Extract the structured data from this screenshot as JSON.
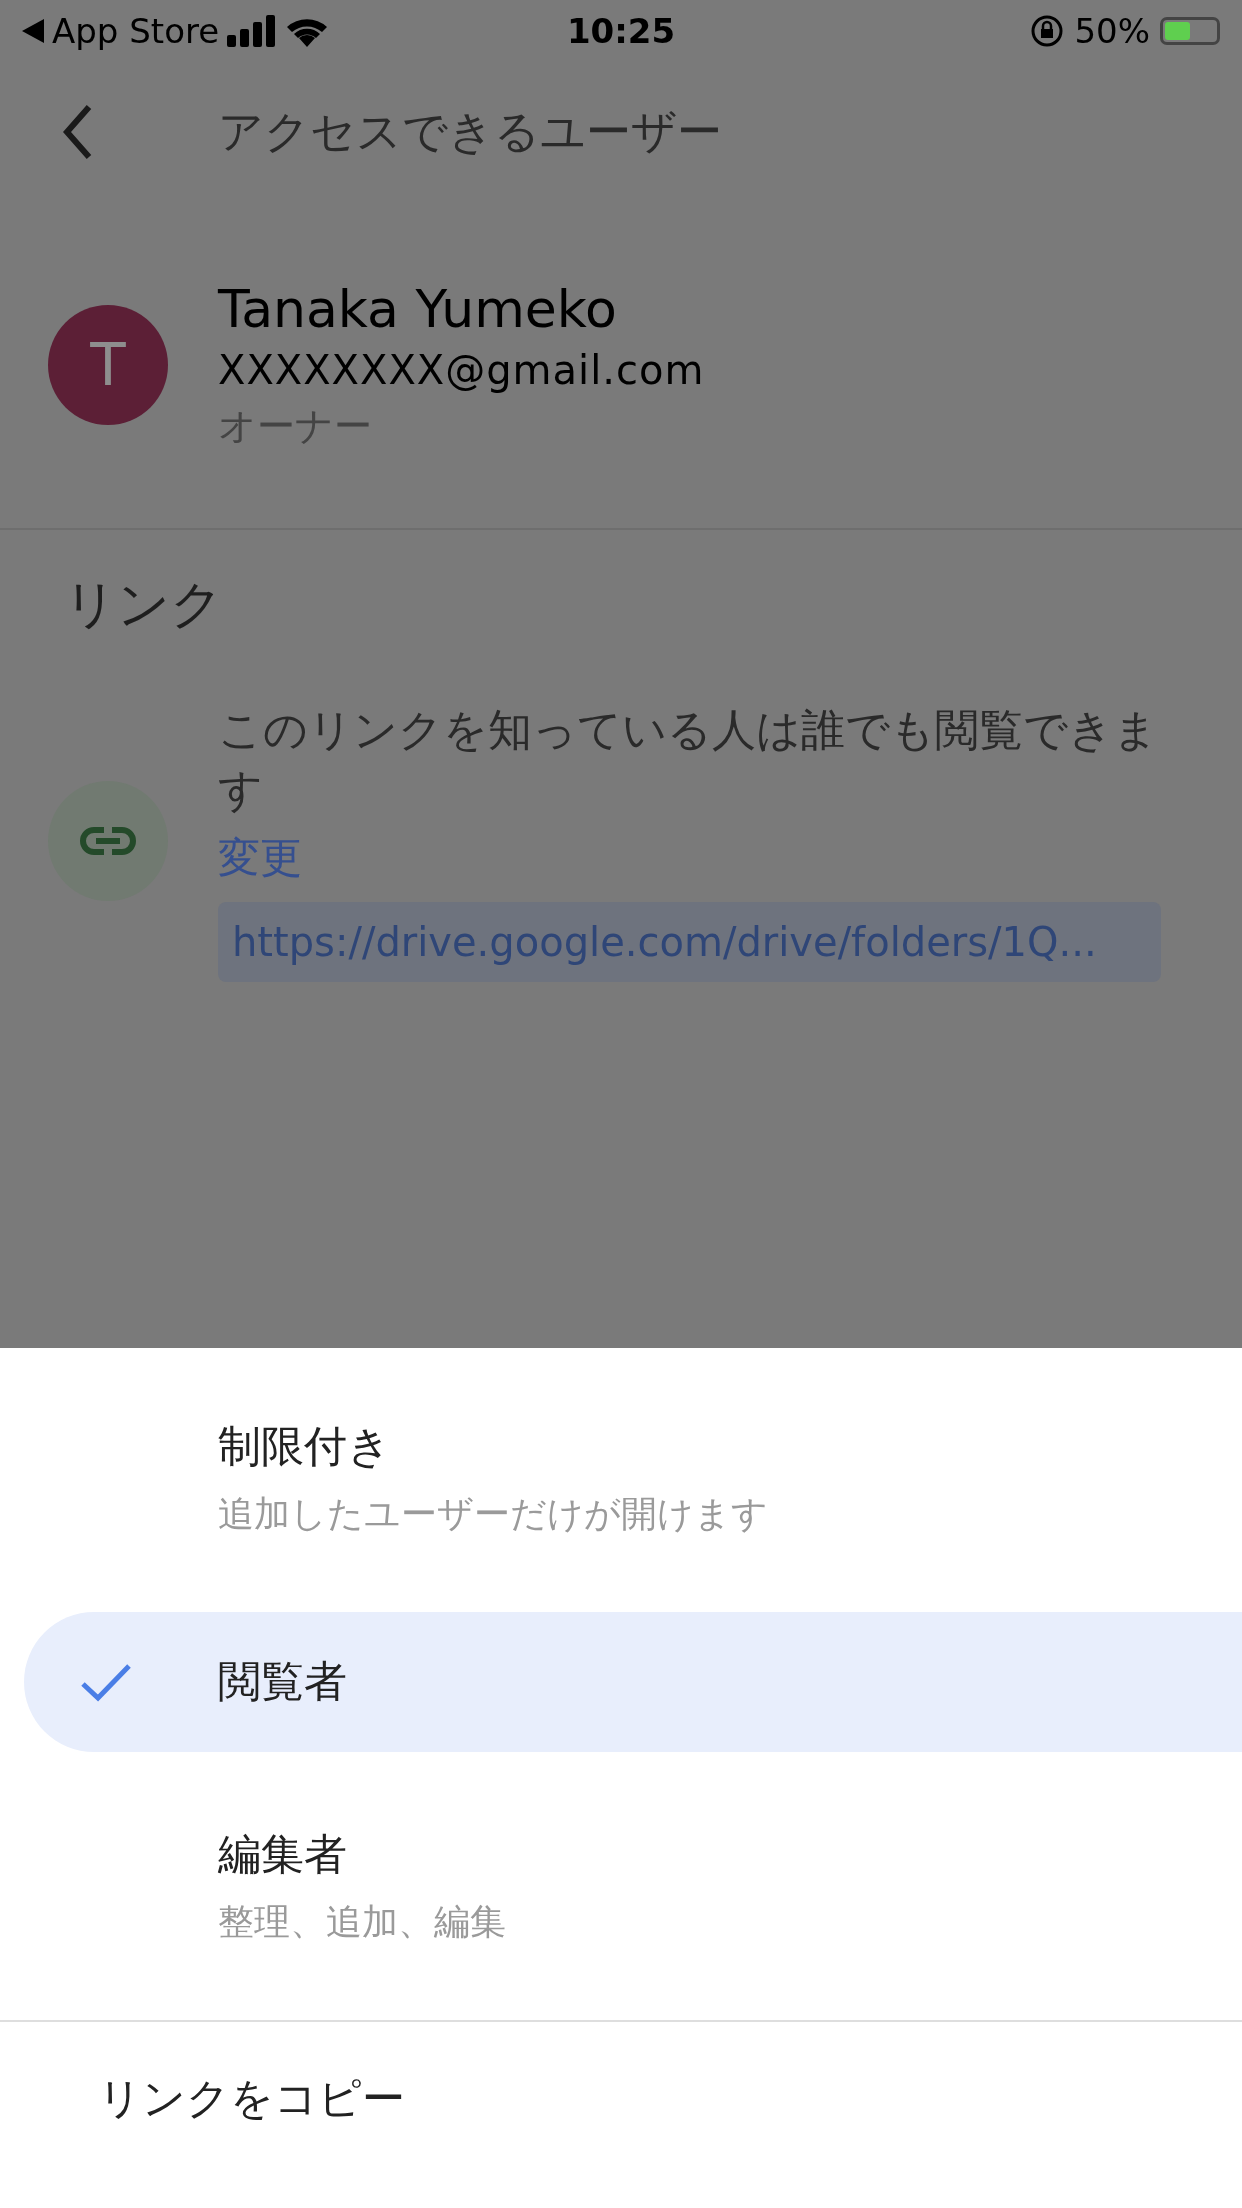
{
  "status_bar": {
    "back_app": "App Store",
    "time": "10:25",
    "battery": "50%"
  },
  "header": {
    "title": "アクセスできるユーザー"
  },
  "owner": {
    "initial": "T",
    "name": "Tanaka Yumeko",
    "email": "XXXXXXXX@gmail.com",
    "role": "オーナー"
  },
  "link_section": {
    "heading": "リンク",
    "description": "このリンクを知っている人は誰でも閲覧できます",
    "change_link": "変更",
    "url": "https://drive.google.com/drive/folders/1Q..."
  },
  "sheet": {
    "options": [
      {
        "label": "制限付き",
        "description": "追加したユーザーだけが開けます",
        "selected": false
      },
      {
        "label": "閲覧者",
        "selected": true
      },
      {
        "label": "編集者",
        "description": "整理、追加、編集",
        "selected": false
      }
    ],
    "copy_action": "リンクをコピー"
  }
}
